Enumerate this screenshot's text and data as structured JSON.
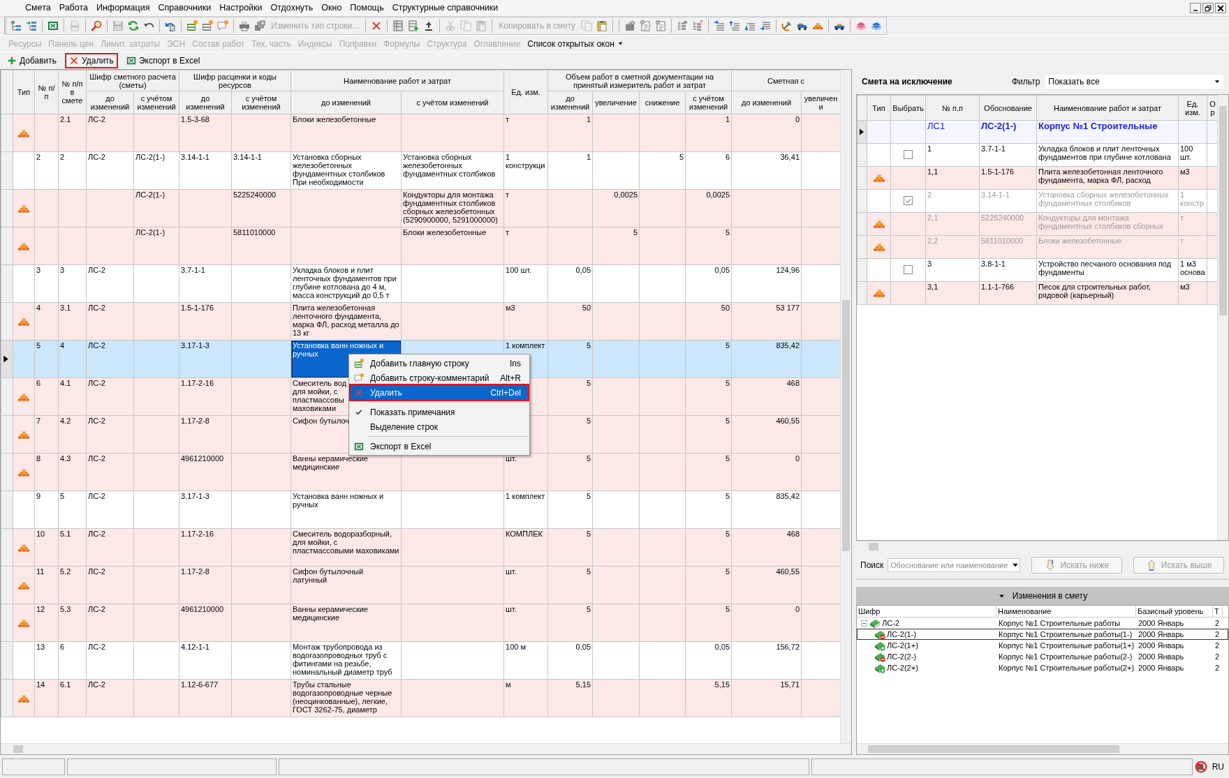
{
  "menu": [
    {
      "label": "Смета"
    },
    {
      "label": "Работа"
    },
    {
      "label": "Информация"
    },
    {
      "label": "Справочники"
    },
    {
      "label": "Настройки"
    },
    {
      "label": "Отдохнуть"
    },
    {
      "label": "Окно"
    },
    {
      "label": "Помощь"
    },
    {
      "label": "Структурные справочники"
    }
  ],
  "toolbar": [
    {
      "kind": "icon",
      "disabled": false
    },
    {
      "kind": "icon",
      "disabled": false
    },
    {
      "kind": "separator"
    },
    {
      "kind": "icon",
      "disabled": false
    },
    {
      "kind": "separator"
    },
    {
      "kind": "icon",
      "disabled": true
    },
    {
      "kind": "separator"
    },
    {
      "kind": "icon",
      "disabled": false
    },
    {
      "kind": "separator"
    },
    {
      "kind": "icon",
      "disabled": true
    },
    {
      "kind": "icon",
      "disabled": false
    },
    {
      "kind": "icon",
      "disabled": false
    },
    {
      "kind": "separator"
    },
    {
      "kind": "icon",
      "disabled": false
    },
    {
      "kind": "separator"
    },
    {
      "kind": "icon",
      "disabled": false
    },
    {
      "kind": "icon",
      "disabled": false
    },
    {
      "kind": "icon",
      "disabled": false
    },
    {
      "kind": "separator"
    },
    {
      "kind": "icon",
      "disabled": false
    },
    {
      "kind": "icon",
      "disabled": false
    },
    {
      "kind": "text",
      "label": "Изменить тип строки...",
      "disabled": true
    },
    {
      "kind": "separator"
    },
    {
      "kind": "icon",
      "disabled": false
    },
    {
      "kind": "separator"
    },
    {
      "kind": "icon",
      "disabled": false
    },
    {
      "kind": "icon",
      "disabled": false
    },
    {
      "kind": "icon",
      "disabled": false
    },
    {
      "kind": "separator"
    },
    {
      "kind": "icon",
      "disabled": true
    },
    {
      "kind": "icon",
      "disabled": true
    },
    {
      "kind": "icon",
      "disabled": true
    },
    {
      "kind": "separator"
    },
    {
      "kind": "text",
      "label": "Копировать в смету",
      "disabled": true
    },
    {
      "kind": "icon",
      "disabled": true
    },
    {
      "kind": "icon",
      "disabled": false
    },
    {
      "kind": "separator"
    },
    {
      "kind": "separator"
    },
    {
      "kind": "icon",
      "disabled": false
    },
    {
      "kind": "icon",
      "disabled": false
    },
    {
      "kind": "icon",
      "disabled": false
    },
    {
      "kind": "separator"
    },
    {
      "kind": "icon",
      "disabled": false
    },
    {
      "kind": "icon",
      "disabled": false
    },
    {
      "kind": "separator"
    },
    {
      "kind": "icon",
      "disabled": false
    },
    {
      "kind": "icon",
      "disabled": false
    },
    {
      "kind": "icon",
      "disabled": false
    },
    {
      "kind": "icon",
      "disabled": false
    },
    {
      "kind": "separator"
    },
    {
      "kind": "icon",
      "disabled": false
    },
    {
      "kind": "icon",
      "disabled": false
    },
    {
      "kind": "icon",
      "disabled": false
    },
    {
      "kind": "separator"
    },
    {
      "kind": "icon",
      "disabled": false
    },
    {
      "kind": "separator"
    },
    {
      "kind": "icon",
      "disabled": false
    },
    {
      "kind": "icon",
      "disabled": false
    }
  ],
  "panels": [
    {
      "label": "Ресурсы",
      "disabled": true
    },
    {
      "label": "Панель цен",
      "disabled": true
    },
    {
      "label": "Лимит. затраты",
      "disabled": true
    },
    {
      "label": "ЭСН",
      "disabled": true
    },
    {
      "label": "Состав работ",
      "disabled": true
    },
    {
      "label": "Тех. часть",
      "disabled": true
    },
    {
      "label": "Индексы",
      "disabled": true
    },
    {
      "label": "Поправки",
      "disabled": true
    },
    {
      "label": "Формулы",
      "disabled": true
    },
    {
      "label": "Структура",
      "disabled": true
    },
    {
      "label": "Оглавление",
      "disabled": true
    },
    {
      "label": "Список открытых окон",
      "disabled": false
    }
  ],
  "actions": [
    {
      "kind": "add",
      "label": "Добавить",
      "highlighted": false
    },
    {
      "kind": "delete",
      "label": "Удалить",
      "highlighted": true
    },
    {
      "kind": "excel",
      "label": "Экспорт в Excel",
      "highlighted": false
    }
  ],
  "table": {
    "columns": [
      {
        "label": "Тип"
      },
      {
        "label": "№ п/п"
      },
      {
        "label": "№ п/п в смете"
      },
      {
        "label": "Шифр сметного расчета (сметы)",
        "children": [
          {
            "label": "до изменений"
          },
          {
            "label": "с учётом изменений"
          }
        ]
      },
      {
        "label": "Шифр расценки и коды ресурсов",
        "children": [
          {
            "label": "до изменений"
          },
          {
            "label": "с учётом изменений"
          }
        ]
      },
      {
        "label": "Наименование работ и затрат",
        "children": [
          {
            "label": "до изменений"
          },
          {
            "label": "с учётом изменений"
          }
        ]
      },
      {
        "label": "Ед. изм."
      },
      {
        "label": "Объем работ в сметной документации на принятый измеритель работ и затрат",
        "children": [
          {
            "label": "до изменений"
          },
          {
            "label": "увеличение"
          },
          {
            "label": "снижение"
          },
          {
            "label": "с учётом изменений"
          }
        ]
      },
      {
        "label": "Сметная с",
        "children": [
          {
            "label": "до изменений"
          },
          {
            "label": "увеличени"
          }
        ]
      }
    ],
    "rows": [
      {
        "kind": "resource",
        "selected": false,
        "name_focused": false,
        "no_in_estimate": "2.1",
        "estimate_code_before": "ЛС-2",
        "rate_code_before": "1.5-3-68",
        "name_before": "Блоки железобетонные",
        "unit": "т",
        "volume_before": "1",
        "volume_after": "1",
        "cost_before": "0"
      },
      {
        "kind": "work",
        "selected": false,
        "name_focused": false,
        "no": "2",
        "no_in_estimate": "2",
        "estimate_code_before": "ЛС-2",
        "estimate_code_after": "ЛС-2(1-)",
        "rate_code_before": "3.14-1-1",
        "rate_code_after": "3.14-1-1",
        "name_before": "Установка сборных железобетонных фундаментных столбиков При необходимости",
        "name_after": "Установка сборных железобетонных фундаментных столбиков",
        "unit": "1 конструкци",
        "volume_before": "1",
        "volume_decrease": "5",
        "volume_after": "6",
        "cost_before": "36,41"
      },
      {
        "kind": "resource",
        "selected": false,
        "name_focused": false,
        "estimate_code_after": "ЛС-2(1-)",
        "rate_code_after": "5225240000",
        "name_after": "Кондукторы для монтажа фундаментных столбиков сборных железобетонных (5290900000, 5291000000)",
        "unit": "т",
        "volume_increase": "0,0025",
        "volume_after": "0,0025"
      },
      {
        "kind": "resource",
        "selected": false,
        "name_focused": false,
        "estimate_code_after": "ЛС-2(1-)",
        "rate_code_after": "5811010000",
        "name_after": "Блоки железобетонные",
        "unit": "т",
        "volume_increase": "5",
        "volume_after": "5"
      },
      {
        "kind": "work",
        "selected": false,
        "name_focused": false,
        "no": "3",
        "no_in_estimate": "3",
        "estimate_code_before": "ЛС-2",
        "rate_code_before": "3.7-1-1",
        "name_before": "Укладка блоков и плит ленточных фундаментов при глубине котлована до 4 м, масса конструкций до 0,5 т",
        "unit": "100 шт.",
        "volume_before": "0,05",
        "volume_after": "0,05",
        "cost_before": "124,96"
      },
      {
        "kind": "resource",
        "selected": false,
        "name_focused": false,
        "no": "4",
        "no_in_estimate": "3.1",
        "estimate_code_before": "ЛС-2",
        "rate_code_before": "1.5-1-176",
        "name_before": "Плита железобетонная ленточного фундамента, марка ФЛ, расход металла до 13 кг",
        "unit": "м3",
        "volume_before": "50",
        "volume_after": "50",
        "cost_before": "53 177"
      },
      {
        "kind": "work",
        "selected": true,
        "name_focused": true,
        "no": "5",
        "no_in_estimate": "4",
        "estimate_code_before": "ЛС-2",
        "rate_code_before": "3.17-1-3",
        "name_before": "Установка ванн ножных и ручных",
        "unit": "1 комплект",
        "volume_before": "5",
        "volume_after": "5",
        "cost_before": "835,42"
      },
      {
        "kind": "resource",
        "selected": false,
        "name_focused": false,
        "no": "6",
        "no_in_estimate": "4.1",
        "estimate_code_before": "ЛС-2",
        "rate_code_before": "1.17-2-16",
        "name_before": "Смеситель вод\nдля мойки, с\nпластмассовы\nмаховиками",
        "volume_before": "5",
        "volume_after": "5",
        "cost_before": "468"
      },
      {
        "kind": "resource",
        "selected": false,
        "name_focused": false,
        "no": "7",
        "no_in_estimate": "4.2",
        "estimate_code_before": "ЛС-2",
        "rate_code_before": "1.17-2-8",
        "name_before": "Сифон бутылоч",
        "volume_before": "5",
        "volume_after": "5",
        "cost_before": "460,55"
      },
      {
        "kind": "resource",
        "selected": false,
        "name_focused": false,
        "no": "8",
        "no_in_estimate": "4.3",
        "estimate_code_before": "ЛС-2",
        "rate_code_before": "4961210000",
        "name_before": "Ванны керамические медицинские",
        "unit": "шт.",
        "volume_before": "5",
        "volume_after": "5",
        "cost_before": "0"
      },
      {
        "kind": "work",
        "selected": false,
        "name_focused": false,
        "no": "9",
        "no_in_estimate": "5",
        "estimate_code_before": "ЛС-2",
        "rate_code_before": "3.17-1-3",
        "name_before": "Установка ванн ножных и ручных",
        "unit": "1 комплект",
        "volume_before": "5",
        "volume_after": "5",
        "cost_before": "835,42"
      },
      {
        "kind": "resource",
        "selected": false,
        "name_focused": false,
        "no": "10",
        "no_in_estimate": "5.1",
        "estimate_code_before": "ЛС-2",
        "rate_code_before": "1.17-2-16",
        "name_before": "Смеситель водоразборный, для мойки, с пластмассовыми маховиками",
        "unit": "КОМПЛЕК",
        "volume_before": "5",
        "volume_after": "5",
        "cost_before": "468"
      },
      {
        "kind": "resource",
        "selected": false,
        "name_focused": false,
        "no": "11",
        "no_in_estimate": "5.2",
        "estimate_code_before": "ЛС-2",
        "rate_code_before": "1.17-2-8",
        "name_before": "Сифон бутылочный латунный",
        "unit": "шт.",
        "volume_before": "5",
        "volume_after": "5",
        "cost_before": "460,55"
      },
      {
        "kind": "resource",
        "selected": false,
        "name_focused": false,
        "no": "12",
        "no_in_estimate": "5.3",
        "estimate_code_before": "ЛС-2",
        "rate_code_before": "4961210000",
        "name_before": "Ванны керамические медицинские",
        "unit": "шт.",
        "volume_before": "5",
        "volume_after": "5",
        "cost_before": "0"
      },
      {
        "kind": "work",
        "selected": false,
        "name_focused": false,
        "no": "13",
        "no_in_estimate": "6",
        "estimate_code_before": "ЛС-2",
        "rate_code_before": "4.12-1-1",
        "name_before": "Монтаж трубопровода из водогазопроводных труб с фитингами на резьбе, номинальный диаметр труб",
        "unit": "100 м",
        "volume_before": "0,05",
        "volume_after": "0,05",
        "cost_before": "156,72"
      },
      {
        "kind": "resource",
        "selected": false,
        "name_focused": false,
        "no": "14",
        "no_in_estimate": "6.1",
        "estimate_code_before": "ЛС-2",
        "rate_code_before": "1.12-6-677",
        "name_before": "Трубы стальные водогазопроводные черные (неоцинкованные), легкие, ГОСТ 3262-75, диаметр",
        "unit": "м",
        "volume_before": "5,15",
        "volume_after": "5,15",
        "cost_before": "15,71"
      }
    ]
  },
  "context_menu": [
    {
      "kind": "add-row",
      "label": "Добавить главную строку",
      "shortcut": "Ins",
      "selected": false,
      "highlighted": false
    },
    {
      "kind": "comment",
      "label": "Добавить строку-комментарий",
      "shortcut": "Alt+R",
      "selected": false,
      "highlighted": false
    },
    {
      "kind": "delete",
      "label": "Удалить",
      "shortcut": "Ctrl+Del",
      "selected": true,
      "highlighted": true
    },
    {
      "kind": "separator"
    },
    {
      "kind": "check",
      "label": "Показать примечания",
      "checked": true,
      "selected": false,
      "highlighted": false
    },
    {
      "kind": "plain",
      "label": "Выделение строк",
      "selected": false,
      "highlighted": false
    },
    {
      "kind": "separator"
    },
    {
      "kind": "excel",
      "label": "Экспорт в Excel",
      "selected": false,
      "highlighted": false
    }
  ],
  "exclusion": {
    "title": "Смета на исключение",
    "filter_label": "Фильтр",
    "filter_value": "Показать все",
    "columns": [
      "Тип",
      "Выбрать",
      "№ п.п",
      "Обоснование",
      "Наименование работ и затрат",
      "Ед. изм.",
      "О р"
    ],
    "rows": [
      {
        "kind": "group",
        "selected": true,
        "disabled": false,
        "no": "ЛС1",
        "basis": "ЛС-2(1-)",
        "name": "Корпус №1 Строительные"
      },
      {
        "kind": "work",
        "selected": false,
        "disabled": false,
        "checked": false,
        "no": "1",
        "basis": "3.7-1-1",
        "name": "Укладка блоков и плит ленточных фундаментов при глубине котлована",
        "unit": "100 шт."
      },
      {
        "kind": "resource",
        "selected": false,
        "disabled": false,
        "no": "1,1",
        "basis": "1.5-1-176",
        "name": "Плита железобетонная ленточного фундамента, марка ФЛ, расход",
        "unit": "м3"
      },
      {
        "kind": "work",
        "selected": false,
        "disabled": true,
        "checked": true,
        "no": "2",
        "basis": "3.14-1-1",
        "name": "Установка сборных железобетонных фундаментных столбиков",
        "unit": "1 констр"
      },
      {
        "kind": "resource",
        "selected": false,
        "disabled": true,
        "no": "2,1",
        "basis": "5225240000",
        "name": "Кондукторы для монтажа фундаментных столбиков сборных",
        "unit": "т"
      },
      {
        "kind": "resource",
        "selected": false,
        "disabled": true,
        "no": "2,2",
        "basis": "5811010000",
        "name": "Блоки железобетонные",
        "unit": "т"
      },
      {
        "kind": "work",
        "selected": false,
        "disabled": false,
        "checked": false,
        "no": "3",
        "basis": "3.8-1-1",
        "name": "Устройство песчаного основания под фундаменты",
        "unit": "1 м3 основа"
      },
      {
        "kind": "resource",
        "selected": false,
        "disabled": false,
        "no": "3,1",
        "basis": "1.1-1-766",
        "name": "Песок для строительных работ, рядовой (карьерный)",
        "unit": "м3"
      }
    ],
    "search_label": "Поиск",
    "search_placeholder": "Обоснование или наименование",
    "search_buttons": [
      {
        "kind": "down",
        "label": "Искать ниже",
        "disabled": true
      },
      {
        "kind": "up",
        "label": "Искать выше",
        "disabled": true
      }
    ]
  },
  "changes": {
    "title": "Изменения в смету",
    "expanded": true,
    "columns": [
      "Шифр",
      "Наименование",
      "Базисный уровень",
      "Т"
    ],
    "tree": [
      {
        "kind": "estimate",
        "code": "ЛС-2",
        "name": "Корпус №1 Строительные работы",
        "base_level": "2000 Январь",
        "column_4": "2",
        "selected": false,
        "expanded": true,
        "children": [
          {
            "kind": "minus",
            "code": "ЛС-2(1-)",
            "name": "Корпус №1 Строительные работы(1-)",
            "base_level": "2000 Январь",
            "column_4": "2",
            "selected": true
          },
          {
            "kind": "plus",
            "code": "ЛС-2(1+)",
            "name": "Корпус №1 Строительные работы(1+)",
            "base_level": "2000 Январь",
            "column_4": "2",
            "selected": false
          },
          {
            "kind": "minus",
            "code": "ЛС-2(2-)",
            "name": "Корпус №1 Строительные работы(2-)",
            "base_level": "2000 Январь",
            "column_4": "2",
            "selected": false
          },
          {
            "kind": "plus",
            "code": "ЛС-2(2+)",
            "name": "Корпус №1 Строительные работы(2+)",
            "base_level": "2000 Январь",
            "column_4": "2",
            "selected": false
          }
        ]
      }
    ]
  },
  "status_bar": {
    "language": "RU"
  }
}
